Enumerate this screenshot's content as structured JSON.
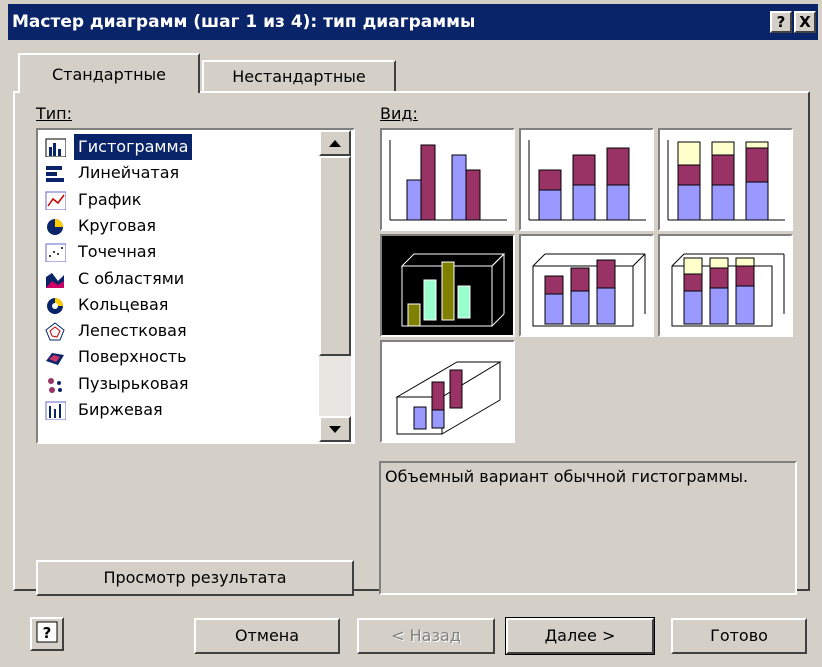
{
  "title": "Мастер диаграмм (шаг 1 из 4): тип диаграммы",
  "title_buttons": {
    "help": "?",
    "close": "X"
  },
  "tabs": [
    {
      "label": "Стандартные"
    },
    {
      "label": "Нестандартные"
    }
  ],
  "type_label": "Тип:",
  "view_label": "Вид:",
  "chart_types": [
    {
      "label": "Гистограмма",
      "icon": "column-chart-icon",
      "selected": true
    },
    {
      "label": "Линейчатая",
      "icon": "bar-chart-icon"
    },
    {
      "label": "График",
      "icon": "line-chart-icon"
    },
    {
      "label": "Круговая",
      "icon": "pie-chart-icon"
    },
    {
      "label": "Точечная",
      "icon": "scatter-chart-icon"
    },
    {
      "label": "С областями",
      "icon": "area-chart-icon"
    },
    {
      "label": "Кольцевая",
      "icon": "doughnut-chart-icon"
    },
    {
      "label": "Лепестковая",
      "icon": "radar-chart-icon"
    },
    {
      "label": "Поверхность",
      "icon": "surface-chart-icon"
    },
    {
      "label": "Пузырьковая",
      "icon": "bubble-chart-icon"
    },
    {
      "label": "Биржевая",
      "icon": "stock-chart-icon"
    }
  ],
  "subtypes": [
    {
      "name": "clustered-column"
    },
    {
      "name": "stacked-column"
    },
    {
      "name": "100-stacked-column"
    },
    {
      "name": "3d-clustered-column",
      "selected": true
    },
    {
      "name": "3d-stacked-column"
    },
    {
      "name": "3d-100-stacked-column"
    },
    {
      "name": "3d-column"
    }
  ],
  "description": "Объемный вариант обычной гистограммы.",
  "preview_button": "Просмотр результата",
  "buttons": {
    "help": "?",
    "cancel": "Отмена",
    "back": "< Назад",
    "next": "Далее >",
    "finish": "Готово"
  },
  "colors": {
    "title_bar": "#0a246a",
    "face": "#d4d0c8",
    "series_blue": "#9999ff",
    "series_plum": "#993366",
    "series_cream": "#ffffcc"
  }
}
